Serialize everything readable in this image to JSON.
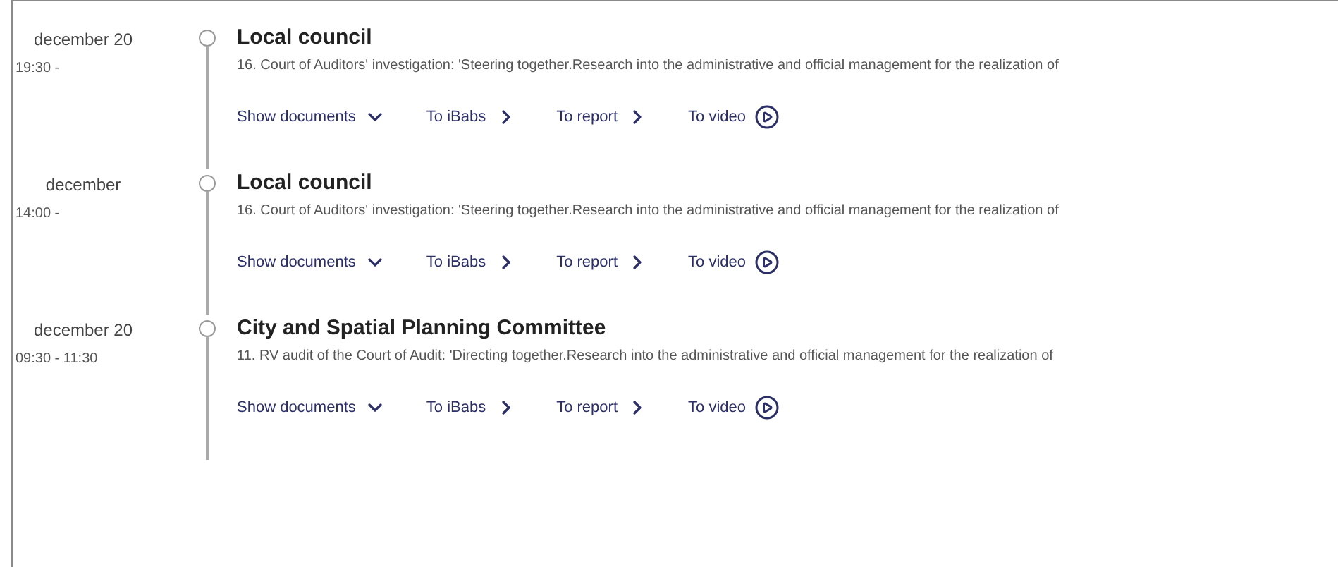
{
  "events": [
    {
      "date": "december 20",
      "time": "19:30 -",
      "title": "Local council",
      "description": "16. Court of Auditors' investigation: 'Steering together.Research into the administrative and official management for the realization of",
      "links": [
        {
          "label": "Show documents",
          "kind": "expand"
        },
        {
          "label": "To iBabs",
          "kind": "go"
        },
        {
          "label": "To report",
          "kind": "go"
        },
        {
          "label": "To video",
          "kind": "play"
        }
      ]
    },
    {
      "date": "december",
      "time": "14:00 -",
      "title": "Local council",
      "description": "16. Court of Auditors' investigation: 'Steering together.Research into the administrative and official management for the realization of",
      "links": [
        {
          "label": "Show documents",
          "kind": "expand"
        },
        {
          "label": "To iBabs",
          "kind": "go"
        },
        {
          "label": "To report",
          "kind": "go"
        },
        {
          "label": "To video",
          "kind": "play"
        }
      ]
    },
    {
      "date": "december 20",
      "time": "09:30 - 11:30",
      "title": "City and Spatial Planning Committee",
      "description": "11. RV audit of the Court of Audit: 'Directing together.Research into the administrative and official management for the realization of",
      "links": [
        {
          "label": "Show documents",
          "kind": "expand"
        },
        {
          "label": "To iBabs",
          "kind": "go"
        },
        {
          "label": "To report",
          "kind": "go"
        },
        {
          "label": "To video",
          "kind": "play"
        }
      ]
    }
  ]
}
